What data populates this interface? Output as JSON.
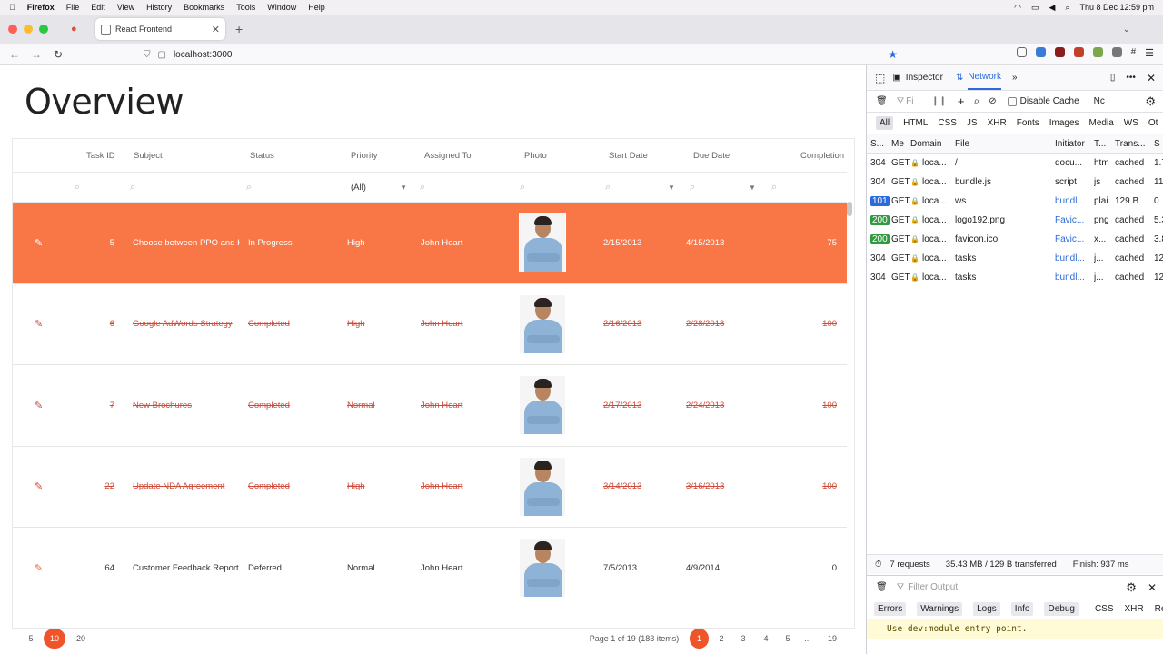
{
  "mac": {
    "menus": [
      "Firefox",
      "File",
      "Edit",
      "View",
      "History",
      "Bookmarks",
      "Tools",
      "Window",
      "Help"
    ],
    "clock": "Thu 8 Dec  12:59 pm"
  },
  "browser": {
    "tab_title": "React Frontend",
    "url": "localhost:3000",
    "new_tab": "+",
    "close": "✕"
  },
  "page": {
    "title": "Overview"
  },
  "grid": {
    "columns": [
      "Task ID",
      "Subject",
      "Status",
      "Priority",
      "Assigned To",
      "Photo",
      "Start Date",
      "Due Date",
      "Completion"
    ],
    "priority_filter": "(All)",
    "rows": [
      {
        "id": "5",
        "subject": "Choose between PPO and H",
        "status": "In Progress",
        "priority": "High",
        "assigned": "John Heart",
        "start": "2/15/2013",
        "due": "4/15/2013",
        "completion": "75",
        "done": false,
        "selected": true
      },
      {
        "id": "6",
        "subject": "Google AdWords Strategy",
        "status": "Completed",
        "priority": "High",
        "assigned": "John Heart",
        "start": "2/16/2013",
        "due": "2/28/2013",
        "completion": "100",
        "done": true,
        "selected": false
      },
      {
        "id": "7",
        "subject": "New Brochures",
        "status": "Completed",
        "priority": "Normal",
        "assigned": "John Heart",
        "start": "2/17/2013",
        "due": "2/24/2013",
        "completion": "100",
        "done": true,
        "selected": false
      },
      {
        "id": "22",
        "subject": "Update NDA Agreement",
        "status": "Completed",
        "priority": "High",
        "assigned": "John Heart",
        "start": "3/14/2013",
        "due": "3/16/2013",
        "completion": "100",
        "done": true,
        "selected": false
      },
      {
        "id": "64",
        "subject": "Customer Feedback Report",
        "status": "Deferred",
        "priority": "Normal",
        "assigned": "John Heart",
        "start": "7/5/2013",
        "due": "4/9/2014",
        "completion": "0",
        "done": false,
        "selected": false
      }
    ]
  },
  "pager": {
    "sizes": [
      "5",
      "10",
      "20"
    ],
    "active_size": "10",
    "info": "Page 1 of 19 (183 items)",
    "pages": [
      "1",
      "2",
      "3",
      "4",
      "5",
      "...",
      "19"
    ],
    "active_page": "1"
  },
  "devtools": {
    "tabs": [
      "Inspector",
      "Network"
    ],
    "active_tab": "Network",
    "filter_placeholder": "Fi",
    "disable_cache": "Disable Cache",
    "throttle": "Nc",
    "types": [
      "All",
      "HTML",
      "CSS",
      "JS",
      "XHR",
      "Fonts",
      "Images",
      "Media",
      "WS",
      "Ot"
    ],
    "net_columns": [
      "S...",
      "Me",
      "Domain",
      "File",
      "Initiator",
      "T...",
      "Trans...",
      "S"
    ],
    "requests": [
      {
        "status": "304",
        "method": "GET",
        "domain": "loca...",
        "file": "/",
        "initiator": "docu...",
        "type": "htm",
        "transferred": "cached",
        "size": "1.7",
        "badge": ""
      },
      {
        "status": "304",
        "method": "GET",
        "domain": "loca...",
        "file": "bundle.js",
        "initiator": "script",
        "type": "js",
        "transferred": "cached",
        "size": "11",
        "badge": ""
      },
      {
        "status": "101",
        "method": "GET",
        "domain": "loca...",
        "file": "ws",
        "initiator": "bundl...",
        "type": "plai",
        "transferred": "129 B",
        "size": "0",
        "badge": "#2b6ad9"
      },
      {
        "status": "200",
        "method": "GET",
        "domain": "loca...",
        "file": "logo192.png",
        "initiator": "Favic...",
        "type": "png",
        "transferred": "cached",
        "size": "5.3",
        "badge": "#2f9a3e"
      },
      {
        "status": "200",
        "method": "GET",
        "domain": "loca...",
        "file": "favicon.ico",
        "initiator": "Favic...",
        "type": "x...",
        "transferred": "cached",
        "size": "3.8",
        "badge": "#2f9a3e"
      },
      {
        "status": "304",
        "method": "GET",
        "domain": "loca...",
        "file": "tasks",
        "initiator": "bundl...",
        "type": "j...",
        "transferred": "cached",
        "size": "12",
        "badge": ""
      },
      {
        "status": "304",
        "method": "GET",
        "domain": "loca...",
        "file": "tasks",
        "initiator": "bundl...",
        "type": "j...",
        "transferred": "cached",
        "size": "12",
        "badge": ""
      }
    ],
    "summary": {
      "requests": "7 requests",
      "transferred": "35.43 MB / 129 B transferred",
      "finish": "Finish: 937 ms"
    },
    "console": {
      "filter_placeholder": "Filter Output",
      "filters": [
        "Errors",
        "Warnings",
        "Logs",
        "Info",
        "Debug",
        "CSS",
        "XHR",
        "Requests"
      ],
      "message": "Use dev:module entry point."
    }
  },
  "colors": {
    "accent": "#f97646",
    "active_page": "#f0552a",
    "completed_text": "#cf4b3a",
    "network_blue": "#2b6ad9"
  }
}
